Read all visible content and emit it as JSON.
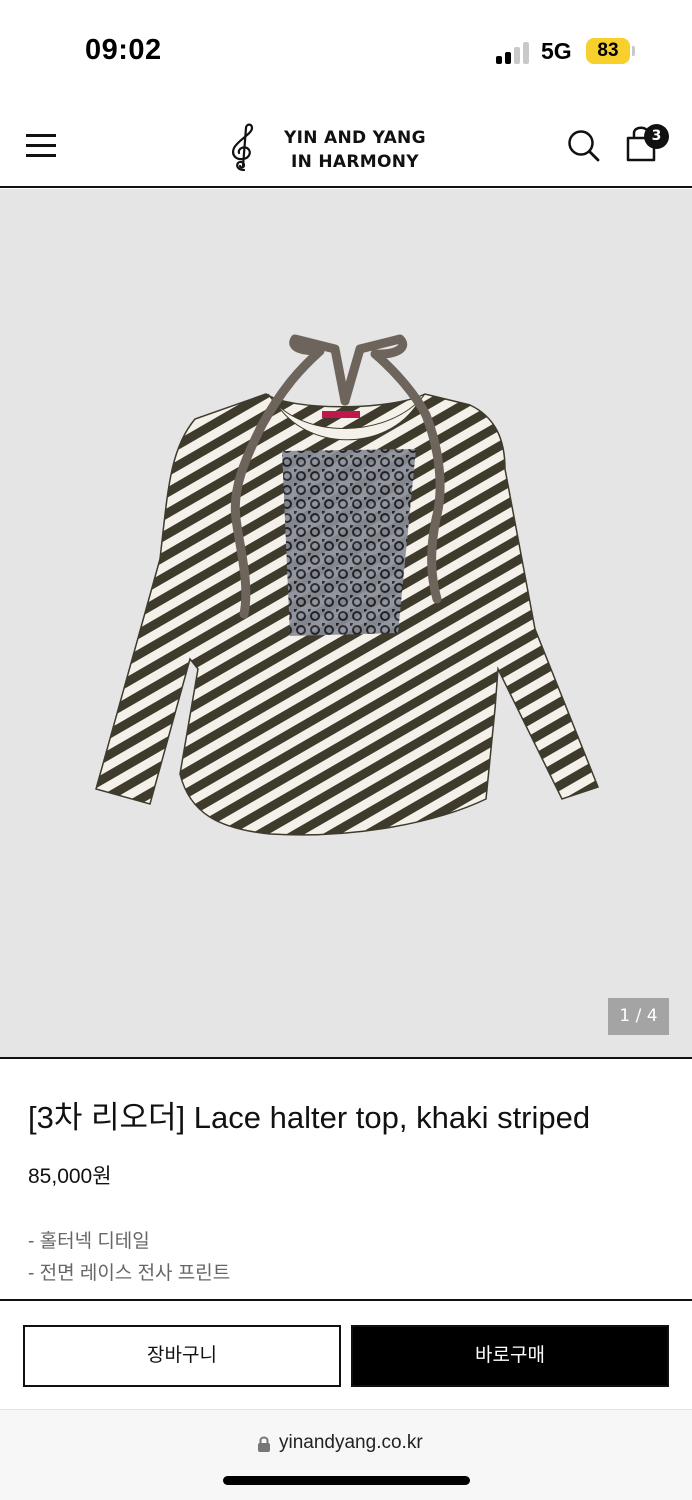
{
  "status_bar": {
    "time": "09:02",
    "network": "5G",
    "battery": "83",
    "battery_color": "#f7d02c"
  },
  "header": {
    "brand_line1": "YIN AND YANG",
    "brand_line2": "IN HARMONY",
    "logo_icon": "treble-clef-icon",
    "cart_count": "3"
  },
  "gallery": {
    "counter": "1 / 4",
    "current_slide": 1,
    "total_slides": 4
  },
  "product": {
    "title": "[3차 리오더] Lace halter top, khaki striped",
    "price": "85,000원",
    "details": [
      "- 홀터넥 디테일",
      "- 전면 레이스 전사 프린트"
    ]
  },
  "actions": {
    "cart_label": "장바구니",
    "buy_label": "바로구매"
  },
  "browser": {
    "url": "yinandyang.co.kr"
  }
}
